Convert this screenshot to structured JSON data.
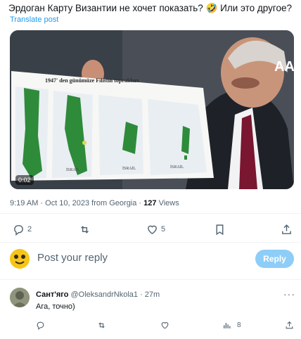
{
  "post": {
    "text": "Эрдоган Карту Византии не хочет показать? 🤣 Или это другое?",
    "translate_label": "Translate post",
    "video": {
      "duration": "0:02",
      "map_title": "1947' den günümüze Filistin toprakları",
      "map_labels": [
        "İSRAİL",
        "İSRAİL",
        "İSRAİL"
      ],
      "watermark": "AA"
    },
    "meta": {
      "time": "9:19 AM · Oct 10, 2023 from Georgia · ",
      "views_count": "127",
      "views_label": " Views"
    },
    "actions": {
      "replies": "2",
      "reposts": "",
      "likes": "5",
      "bookmark": "",
      "share": ""
    }
  },
  "reply_box": {
    "placeholder": "Post your reply",
    "button_label": "Reply"
  },
  "comment": {
    "name": "Сант'яго",
    "handle": "@OleksandrNkola1 · 27m",
    "text": "Ага, точно)",
    "more": "···",
    "actions": {
      "replies": "",
      "reposts": "",
      "likes": "",
      "views": "8"
    }
  },
  "colors": {
    "accent": "#1d9bf0",
    "reply_button": "#8ecdf7",
    "muted": "#536471"
  },
  "icons": [
    "reply-icon",
    "repost-icon",
    "like-icon",
    "bookmark-icon",
    "share-icon",
    "views-icon",
    "more-icon"
  ]
}
